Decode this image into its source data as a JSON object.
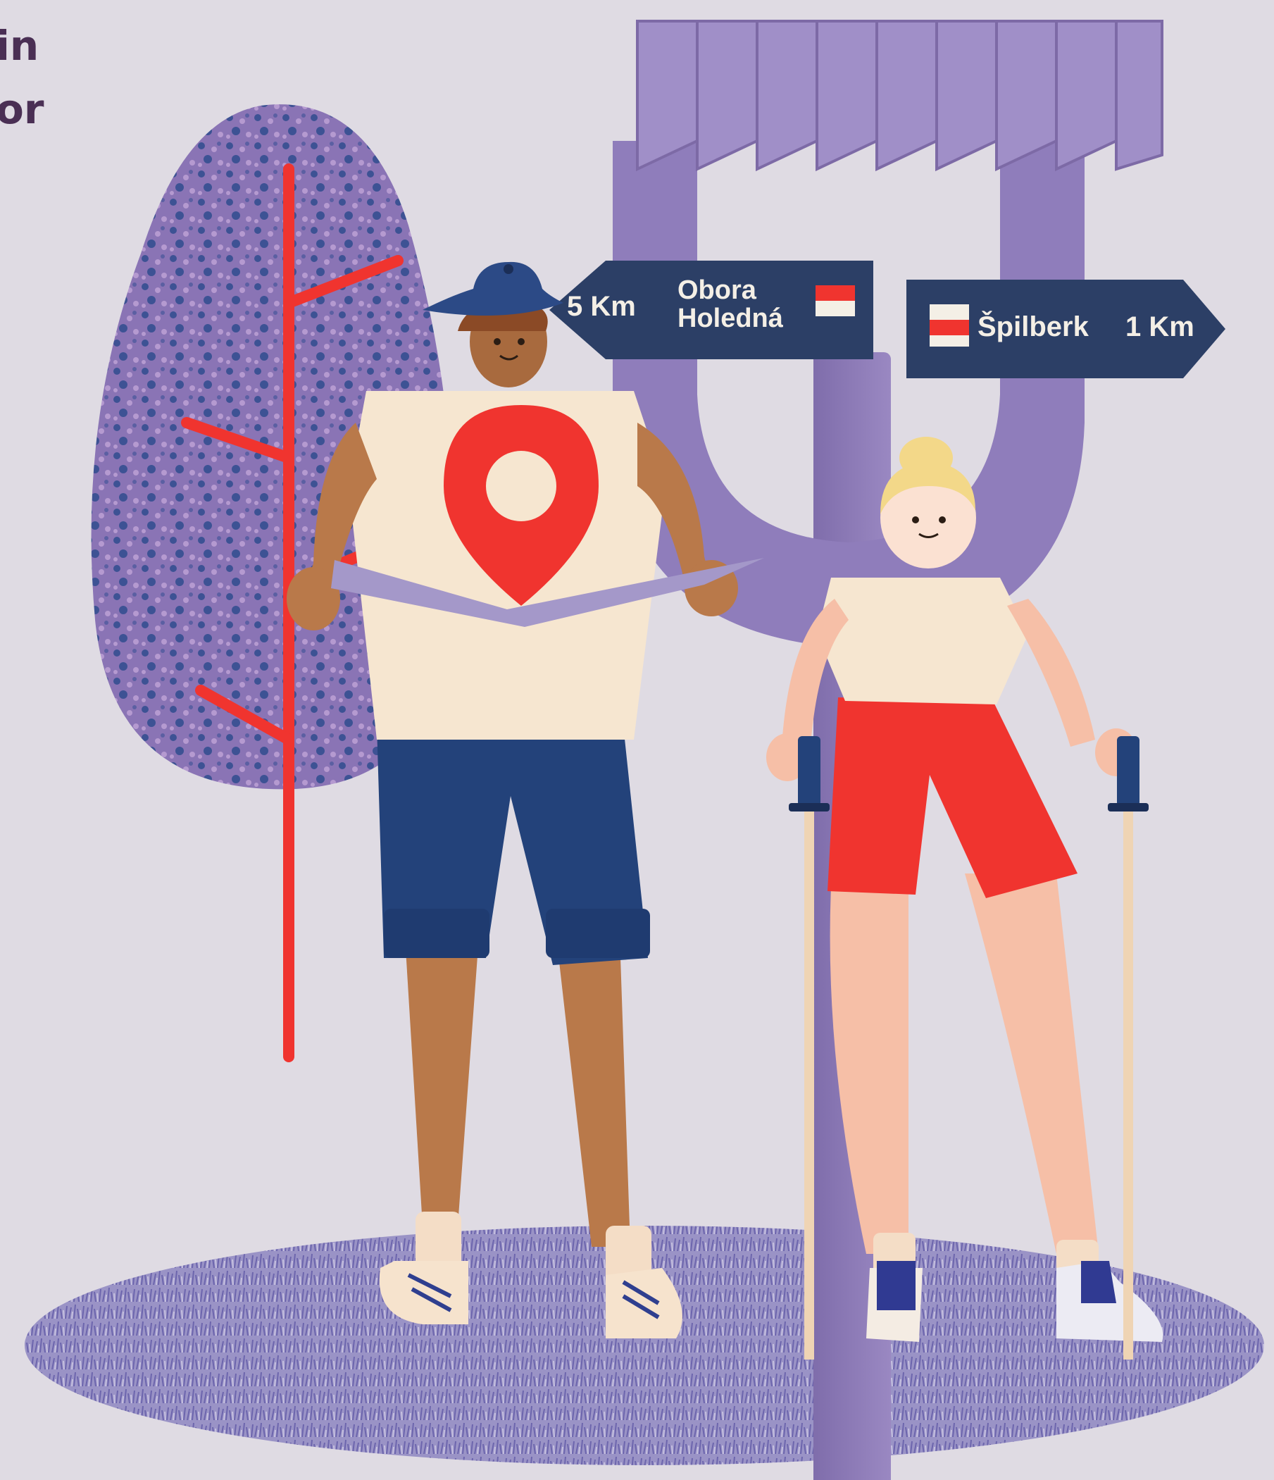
{
  "corner_text": {
    "line1": "in",
    "line2": "or"
  },
  "sign_left": {
    "distance": "5 Km",
    "destination_line1": "Obora",
    "destination_line2": "Holedná"
  },
  "sign_right": {
    "destination": "Špilberk",
    "distance": "1 Km"
  },
  "colors": {
    "background": "#dfdbe3",
    "sign_navy": "#2c3f66",
    "accent_red": "#f0342f",
    "post_purple": "#8b7bb3",
    "tree_purple": "#7d6aa6",
    "ground_purple": "#8e86bd"
  }
}
